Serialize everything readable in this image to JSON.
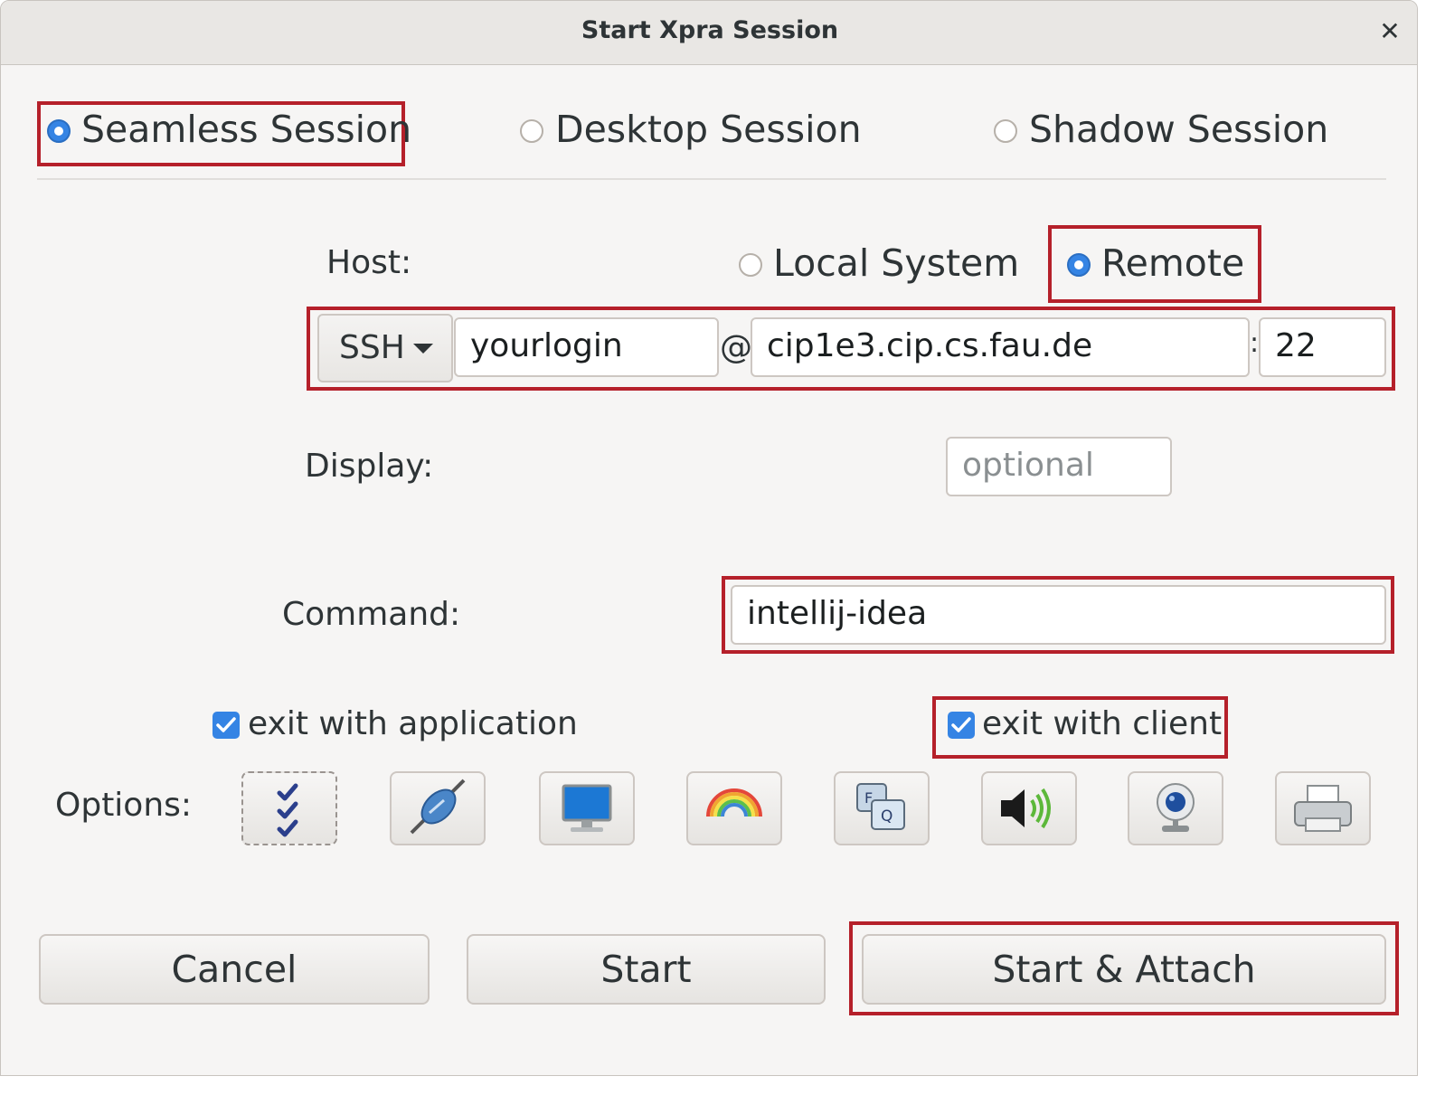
{
  "window": {
    "title": "Start Xpra Session",
    "close_glyph": "✕"
  },
  "session_modes": [
    {
      "label": "Seamless Session",
      "selected": true
    },
    {
      "label": "Desktop Session",
      "selected": false
    },
    {
      "label": "Shadow Session",
      "selected": false
    }
  ],
  "host": {
    "label": "Host:",
    "local_label": "Local System",
    "remote_label": "Remote",
    "selected": "Remote",
    "protocol": "SSH",
    "username": "yourlogin",
    "at_sign": "@",
    "hostname": "cip1e3.cip.cs.fau.de",
    "port_separator": ":",
    "port": "22"
  },
  "display": {
    "label": "Display:",
    "placeholder": "optional",
    "value": ""
  },
  "command": {
    "label": "Command:",
    "value": "intellij-idea"
  },
  "checkboxes": {
    "exit_with_application": {
      "label": "exit with application",
      "checked": true
    },
    "exit_with_client": {
      "label": "exit with client",
      "checked": true
    }
  },
  "options": {
    "label": "Options:",
    "icons": [
      "features-checklist-icon",
      "network-plug-icon",
      "display-monitor-icon",
      "color-rainbow-icon",
      "keyboard-keys-icon",
      "speaker-audio-icon",
      "webcam-icon",
      "printer-icon"
    ]
  },
  "buttons": {
    "cancel": "Cancel",
    "start": "Start",
    "start_attach": "Start & Attach"
  },
  "colors": {
    "highlight": "#b5202a",
    "accent": "#3584e4",
    "window_bg": "#f6f5f4"
  }
}
